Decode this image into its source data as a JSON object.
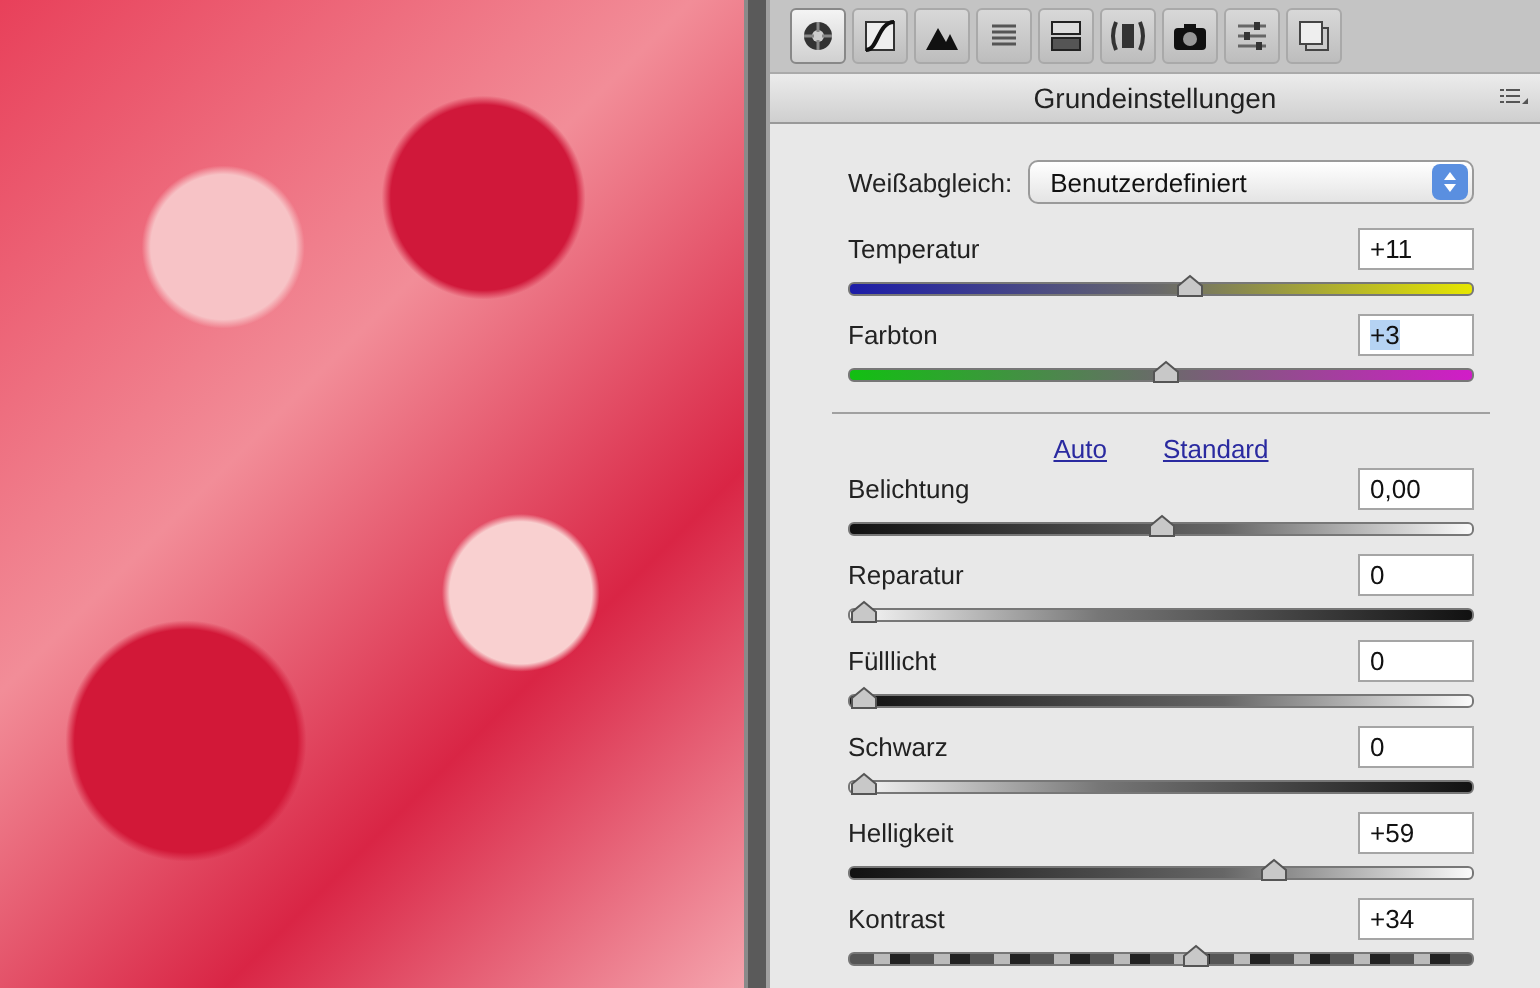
{
  "photo": {
    "kind": "flowers"
  },
  "tabs": [
    {
      "kind": "aperture",
      "selected": true
    },
    {
      "kind": "curve",
      "selected": false
    },
    {
      "kind": "mountains",
      "selected": false
    },
    {
      "kind": "lines",
      "selected": false
    },
    {
      "kind": "split",
      "selected": false
    },
    {
      "kind": "lens",
      "selected": false
    },
    {
      "kind": "camera",
      "selected": false
    },
    {
      "kind": "sliders",
      "selected": false
    },
    {
      "kind": "stack",
      "selected": false
    }
  ],
  "panel": {
    "title": "Grundeinstellungen"
  },
  "white_balance": {
    "label": "Weißabgleich:",
    "value": "Benutzerdefiniert"
  },
  "color_sliders": [
    {
      "label": "Temperatur",
      "value": "+11",
      "level": 0.55,
      "kind": "blue-yellow",
      "focused": false
    },
    {
      "label": "Farbton",
      "value": "+3",
      "level": 0.51,
      "kind": "green-magenta",
      "focused": true
    }
  ],
  "links": [
    "Auto",
    "Standard"
  ],
  "tone_sliders": [
    {
      "label": "Belichtung",
      "value": "0,00",
      "level": 0.5,
      "kind": "dark-light",
      "focused": false
    },
    {
      "label": "Reparatur",
      "value": "0",
      "level": 0,
      "kind": "light-dark",
      "focused": false
    },
    {
      "label": "Fülllicht",
      "value": "0",
      "level": 0,
      "kind": "dark-light",
      "focused": false
    },
    {
      "label": "Schwarz",
      "value": "0",
      "level": 0,
      "kind": "light-dark",
      "focused": false
    },
    {
      "label": "Helligkeit",
      "value": "+59",
      "level": 0.69,
      "kind": "dark-light",
      "focused": false
    },
    {
      "label": "Kontrast",
      "value": "+34",
      "level": 0.56,
      "kind": "contrast",
      "focused": false
    }
  ]
}
